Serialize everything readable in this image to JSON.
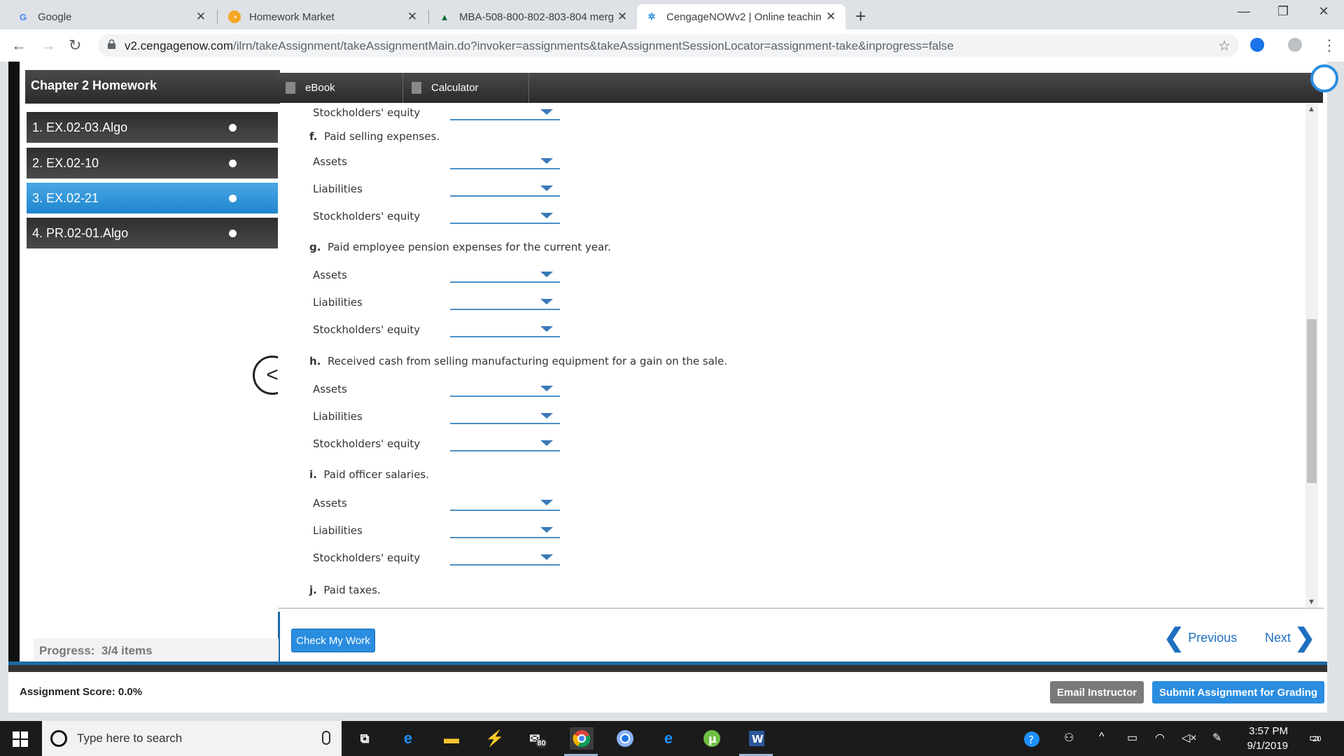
{
  "browser": {
    "tabs": [
      {
        "title": "Google",
        "favicon": "google-favicon"
      },
      {
        "title": "Homework Market",
        "favicon": "homework-market-favicon"
      },
      {
        "title": "MBA-508-800-802-803-804 merg",
        "favicon": "course-favicon"
      },
      {
        "title": "CengageNOWv2 | Online teachin",
        "favicon": "cengage-favicon",
        "active": true
      }
    ],
    "url_host": "v2.cengagenow.com",
    "url_path": "/ilrn/takeAssignment/takeAssignmentMain.do?invoker=assignments&takeAssignmentSessionLocator=assignment-take&inprogress=false"
  },
  "sidebar": {
    "title": "Chapter 2 Homework",
    "items": [
      {
        "label": "1. EX.02-03.Algo"
      },
      {
        "label": "2. EX.02-10"
      },
      {
        "label": "3. EX.02-21",
        "active": true
      },
      {
        "label": "4. PR.02-01.Algo"
      }
    ],
    "progress_label": "Progress:",
    "progress_value": "3/4 items"
  },
  "toolbar": {
    "ebook": "eBook",
    "calculator": "Calculator"
  },
  "question": {
    "top_row": {
      "label": "Stockholders' equity",
      "value": ""
    },
    "transactions": [
      {
        "letter": "f.",
        "text": "Paid selling expenses.",
        "rows": [
          {
            "label": "Assets",
            "value": ""
          },
          {
            "label": "Liabilities",
            "value": ""
          },
          {
            "label": "Stockholders' equity",
            "value": ""
          }
        ]
      },
      {
        "letter": "g.",
        "text": "Paid employee pension expenses for the current year.",
        "rows": [
          {
            "label": "Assets",
            "value": ""
          },
          {
            "label": "Liabilities",
            "value": ""
          },
          {
            "label": "Stockholders' equity",
            "value": ""
          }
        ]
      },
      {
        "letter": "h.",
        "text": "Received cash from selling manufacturing equipment for a gain on the sale.",
        "rows": [
          {
            "label": "Assets",
            "value": ""
          },
          {
            "label": "Liabilities",
            "value": ""
          },
          {
            "label": "Stockholders' equity",
            "value": ""
          }
        ]
      },
      {
        "letter": "i.",
        "text": "Paid officer salaries.",
        "rows": [
          {
            "label": "Assets",
            "value": ""
          },
          {
            "label": "Liabilities",
            "value": ""
          },
          {
            "label": "Stockholders' equity",
            "value": ""
          }
        ]
      },
      {
        "letter": "j.",
        "text": "Paid taxes."
      }
    ]
  },
  "footer": {
    "check_button": "Check My Work",
    "previous": "Previous",
    "next": "Next",
    "score": "Assignment Score: 0.0%",
    "email_button": "Email Instructor",
    "submit_button": "Submit Assignment for Grading"
  },
  "taskbar": {
    "search_placeholder": "Type here to search",
    "mail_badge": "80",
    "time": "3:57 PM",
    "date": "9/1/2019",
    "notification_count": "20"
  },
  "colors": {
    "accent": "#2a8de0",
    "dropdown_line": "#4a90c8",
    "active_item": "#1f85cd"
  }
}
